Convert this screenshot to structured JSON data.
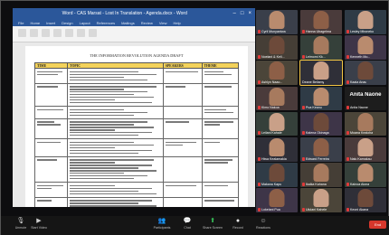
{
  "document": {
    "title": "Word - CAS Marsat - Lost In Translation - Agenda.docx - Word",
    "ribbon_tabs": [
      "File",
      "Home",
      "Insert",
      "Design",
      "Layout",
      "References",
      "Mailings",
      "Review",
      "View",
      "Help"
    ],
    "heading": "THE INFORMATION REVOLUTION AGENDA DRAFT",
    "table": {
      "headers": [
        "TIME",
        "TOPIC",
        "SPEAKERS",
        "THEME"
      ]
    }
  },
  "participants": [
    {
      "name": "Cyril Munyantwa",
      "muted": true
    },
    {
      "name": "Hanna Ubagelma",
      "muted": true
    },
    {
      "name": "Lesley Mboneko",
      "muted": true
    },
    {
      "name": "Noelani & Keli...",
      "muted": true
    },
    {
      "name": "Leimomi Kk...",
      "muted": true
    },
    {
      "name": "Kenneth Mo...",
      "muted": true
    },
    {
      "name": "Ashlyn Naao...",
      "muted": true
    },
    {
      "name": "Deane Bellamy",
      "muted": false
    },
    {
      "name": "Kaala Anau",
      "muted": true
    },
    {
      "name": "Kimo Nakoa",
      "muted": true
    },
    {
      "name": "Pua Keanu",
      "muted": true
    },
    {
      "name": "Anita Naone",
      "muted": true
    },
    {
      "name": "Leilani Kahale",
      "muted": true
    },
    {
      "name": "Kalena Okinaga",
      "muted": true
    },
    {
      "name": "Moana Kealoha",
      "muted": true
    },
    {
      "name": "Hiwa Kealamakia",
      "muted": true
    },
    {
      "name": "Edward Ferreira",
      "muted": true
    },
    {
      "name": "Nalu Kamakau",
      "muted": true
    },
    {
      "name": "Makana Kapu",
      "muted": true
    },
    {
      "name": "Ikaika Kahana",
      "muted": true
    },
    {
      "name": "Kainoa Aiona",
      "muted": true
    },
    {
      "name": "Lokelani Pua",
      "muted": true
    },
    {
      "name": "Ululani Kahele",
      "muted": true
    },
    {
      "name": "Keoni Akana",
      "muted": true
    }
  ],
  "toolbar": {
    "items": [
      {
        "label": "Unmute",
        "icon": "microphone-icon"
      },
      {
        "label": "Start Video",
        "icon": "video-icon"
      },
      {
        "label": "Participants",
        "icon": "participants-icon"
      },
      {
        "label": "Chat",
        "icon": "chat-icon"
      },
      {
        "label": "Share Screen",
        "icon": "share-screen-icon"
      },
      {
        "label": "Record",
        "icon": "record-icon"
      },
      {
        "label": "Reactions",
        "icon": "reactions-icon"
      }
    ],
    "end_label": "End",
    "colors": {
      "end": "#d6372c",
      "speaker_outline": "#f3c744"
    }
  }
}
